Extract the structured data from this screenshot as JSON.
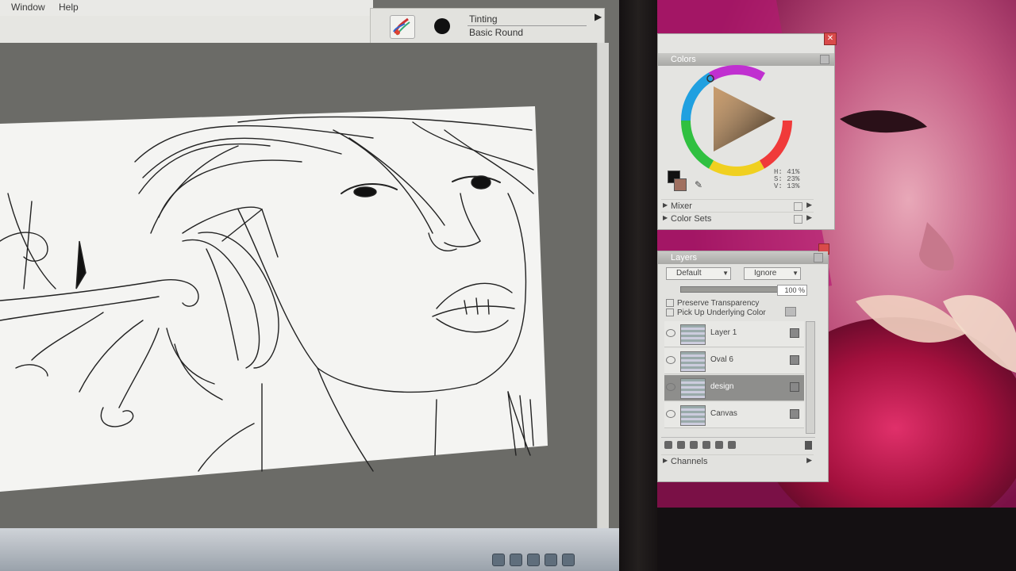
{
  "menubar": {
    "items": [
      "Window",
      "Help"
    ]
  },
  "property_bar": {
    "brush_category": "Tinting",
    "brush_variant": "Basic Round",
    "expand_arrow": "▶"
  },
  "colors_panel": {
    "title": "Colors",
    "hsv": {
      "h": "H: 41%",
      "s": "S: 23%",
      "v": "V: 13%"
    },
    "sections": [
      "Mixer",
      "Color Sets"
    ]
  },
  "layers_panel": {
    "title": "Layers",
    "composite_method": "Default",
    "composite_depth": "Ignore",
    "opacity": "100 %",
    "options": [
      "Preserve Transparency",
      "Pick Up Underlying Color"
    ],
    "layers": [
      {
        "name": "Layer 1",
        "selected": false
      },
      {
        "name": "Oval 6",
        "selected": false
      },
      {
        "name": "design",
        "selected": true
      },
      {
        "name": "Canvas",
        "selected": false
      }
    ],
    "channels_label": "Channels"
  },
  "colors": {
    "workspace": "#6b6b67",
    "panel_bg": "#e4e4e1",
    "photo_magenta": "#c2186e",
    "selected_layer": "#8e8e8c"
  },
  "icons": [
    "brush-icon",
    "color-wheel",
    "eyedropper-icon",
    "lock-icon",
    "trash-icon",
    "eye-icon"
  ]
}
